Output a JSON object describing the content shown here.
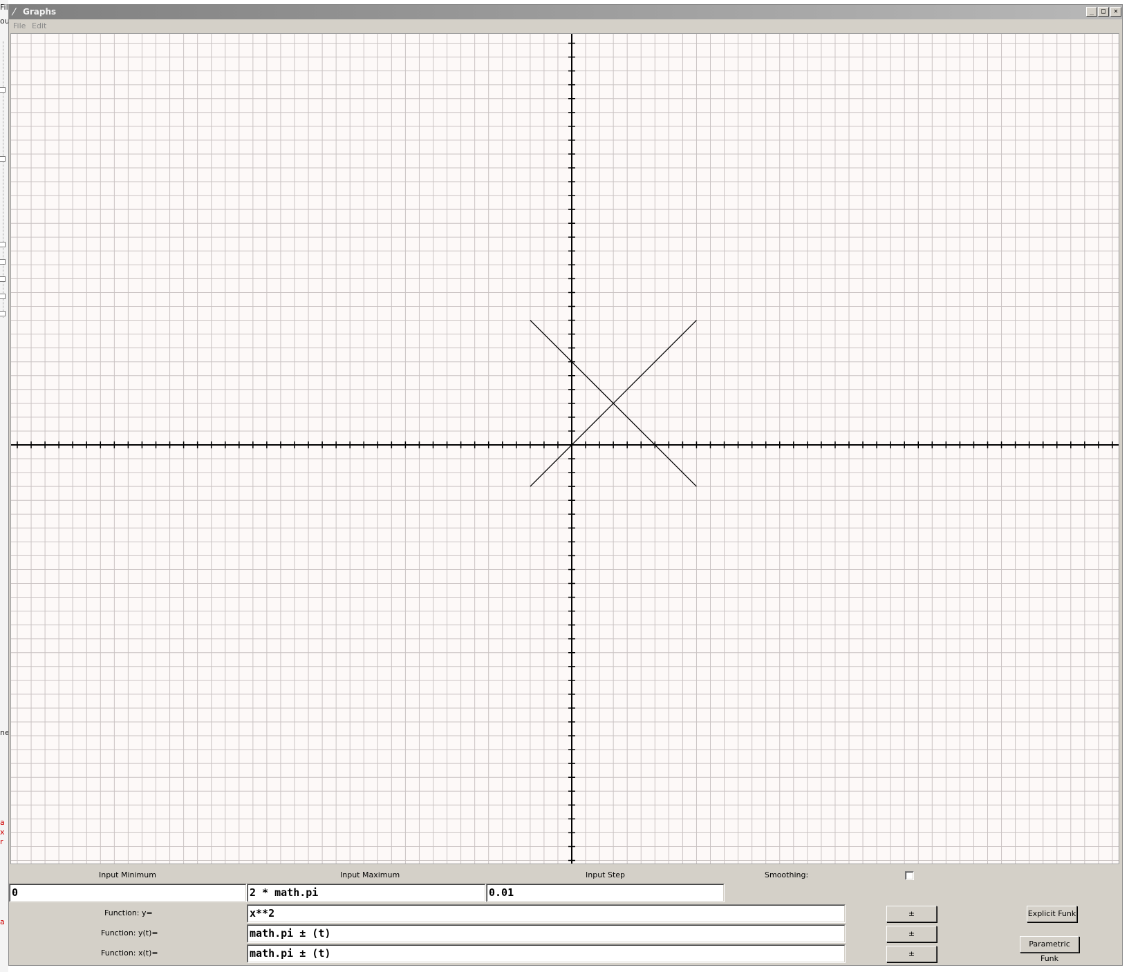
{
  "window": {
    "title": "Graphs",
    "controls": {
      "minimize": "_",
      "maximize": "□",
      "close": "✕"
    }
  },
  "menu": {
    "items": [
      "File",
      "Edit"
    ]
  },
  "background_app": {
    "fragments": [
      "Fil",
      "ou",
      "ne"
    ],
    "red_fragments": [
      "a",
      "x",
      "r",
      "a"
    ]
  },
  "inputs": {
    "min_label": "Input Minimum",
    "max_label": "Input Maximum",
    "step_label": "Input Step",
    "smoothing_label": "Smoothing:",
    "min_value": "0",
    "max_value": "2 * math.pi",
    "step_value": "0.01",
    "smoothing_checked": false
  },
  "functions": {
    "y_label": "Function: y=",
    "yt_label": "Function: y(t)=",
    "xt_label": "Function: x(t)=",
    "y_value": "x**2",
    "yt_value": "math.pi ± (t)",
    "xt_value": "math.pi ± (t)",
    "toggle_label": "±"
  },
  "buttons": {
    "explicit": "Explicit Funk",
    "parametric": "Parametric Funk"
  },
  "chart_data": {
    "type": "line",
    "title": "",
    "xlabel": "",
    "ylabel": "",
    "x_range": [
      -40,
      40
    ],
    "y_range": [
      -30,
      30
    ],
    "grid": true,
    "ticks_every": 1,
    "series": [
      {
        "x": [
          -3,
          9
        ],
        "y": [
          -3,
          9
        ]
      },
      {
        "x": [
          -3,
          9
        ],
        "y": [
          9,
          -3
        ]
      }
    ],
    "colors": {
      "grid": "#c9c2c2",
      "axes": "#000000",
      "lines": "#000000",
      "background": "#fdf9f8"
    }
  }
}
